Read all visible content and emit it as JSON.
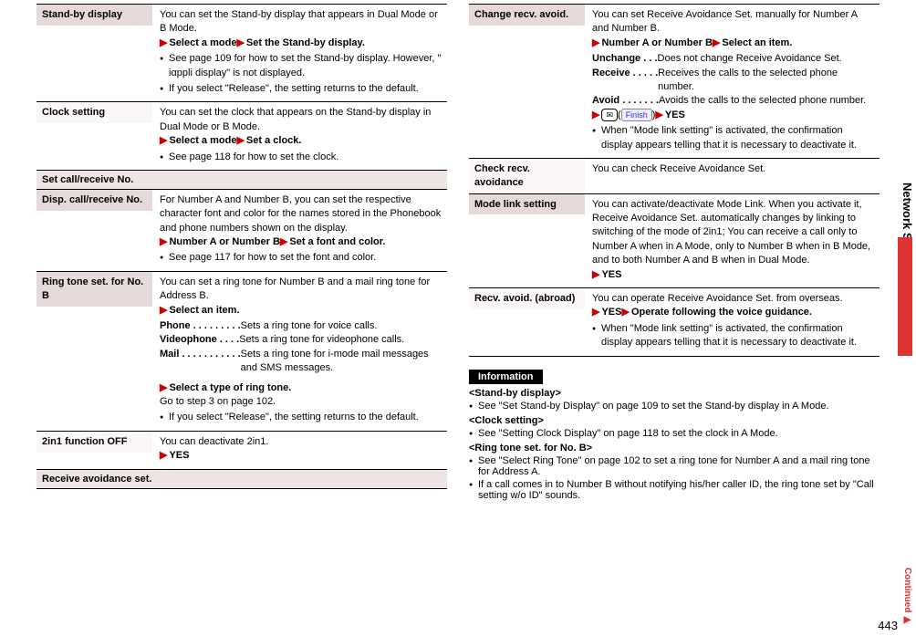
{
  "left": {
    "standby": {
      "label": "Stand-by display",
      "body": "You can set the Stand-by display that appears in Dual Mode or B Mode.",
      "action": [
        "Select a mode",
        "Set the Stand-by display."
      ],
      "bullets": [
        "See page 109 for how to set the Stand-by display. However, \" iαppli display\" is not displayed.",
        "If you select \"Release\", the setting returns to the default."
      ]
    },
    "clock": {
      "label": "Clock setting",
      "body": "You can set the clock that appears on the Stand-by display in Dual Mode or B Mode.",
      "action": [
        "Select a mode",
        "Set a clock."
      ],
      "bullets": [
        "See page 118 for how to set the clock."
      ]
    },
    "section1": "Set call/receive No.",
    "disp": {
      "label": "Disp. call/receive No.",
      "body": "For Number A and Number B, you can set the respective character font and color for the names stored in the Phonebook and phone numbers shown on the display.",
      "action": [
        "Number A or Number B",
        "Set a font and color."
      ],
      "bullets": [
        "See page 117 for how to set the font and color."
      ]
    },
    "ring": {
      "label": "Ring tone set. for No. B",
      "body": "You can set a ring tone for Number B and a mail ring tone for Address B.",
      "select": "Select an item.",
      "items": [
        {
          "term": "Phone  . . . . . . . . . ",
          "def": "Sets a ring tone for voice calls."
        },
        {
          "term": "Videophone  . . . . ",
          "def": "Sets a ring tone for videophone calls."
        },
        {
          "term": "Mail  . . . . . . . . . . . ",
          "def": "Sets a ring tone for i-mode mail messages and SMS messages."
        }
      ],
      "select2": "Select a type of ring tone.",
      "goto": "Go to step 3 on page 102.",
      "bullets": [
        "If you select \"Release\", the setting returns to the default."
      ]
    },
    "off": {
      "label": "2in1 function OFF",
      "body": "You can deactivate 2in1.",
      "action": [
        "YES"
      ]
    },
    "section2": "Receive avoidance set."
  },
  "right": {
    "change": {
      "label": "Change recv. avoid.",
      "body": "You can set Receive Avoidance Set. manually for Number A and Number B.",
      "action1": [
        "Number A or Number B",
        "Select an item."
      ],
      "items": [
        {
          "term": "Unchange . . . ",
          "def": "Does not change Receive Avoidance Set."
        },
        {
          "term": "Receive . . . . . ",
          "def": "Receives the calls to the selected phone number."
        },
        {
          "term": "Avoid . . . . . . . ",
          "def": "Avoids the calls to the selected phone number."
        }
      ],
      "yes": "YES",
      "bullets": [
        "When \"Mode link setting\" is activated, the confirmation display appears telling that it is necessary to deactivate it."
      ]
    },
    "check": {
      "label": "Check recv. avoidance",
      "body": "You can check Receive Avoidance Set."
    },
    "mode": {
      "label": "Mode link setting",
      "body": "You can activate/deactivate Mode Link. When you activate it, Receive Avoidance Set. automatically changes by linking to switching of the mode of 2in1; You can receive a call only to Number A when in A Mode, only to Number B when in B Mode, and to both Number A and B when in Dual Mode.",
      "action": [
        "YES"
      ]
    },
    "abroad": {
      "label": "Recv. avoid. (abroad)",
      "body": "You can operate Receive Avoidance Set. from overseas.",
      "action": [
        "YES",
        "Operate following the voice guidance."
      ],
      "bullets": [
        "When \"Mode link setting\" is activated, the confirmation display appears telling that it is necessary to deactivate it."
      ]
    },
    "info": {
      "tag": "Information",
      "s1t": "<Stand-by display>",
      "s1b": "See \"Set Stand-by Display\" on page 109 to set the Stand-by display in A Mode.",
      "s2t": "<Clock setting>",
      "s2b": "See \"Setting Clock Display\" on page 118 to set the clock in A Mode.",
      "s3t": "<Ring tone set. for No. B>",
      "s3b1": "See \"Select Ring Tone\" on page 102 to set a ring tone for Number A and a mail ring tone for Address A.",
      "s3b2": "If a call comes in to Number B without notifying his/her caller ID, the ring tone set by \"Call setting w/o ID\" sounds."
    }
  },
  "side": "Network Services",
  "pagenum": "443",
  "continued": "Continued ▶"
}
